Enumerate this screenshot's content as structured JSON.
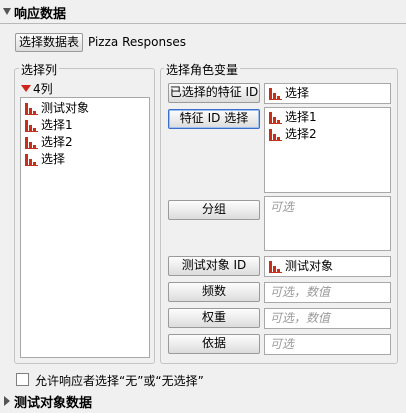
{
  "header": {
    "title": "响应数据"
  },
  "data_table": {
    "button_label": "选择数据表",
    "table_name": "Pizza Responses"
  },
  "columns_panel": {
    "label": "选择列",
    "count_label": "4列",
    "items": [
      {
        "label": "测试对象",
        "icon": "bar-chart-icon"
      },
      {
        "label": "选择1",
        "icon": "bar-chart-icon"
      },
      {
        "label": "选择2",
        "icon": "bar-chart-icon"
      },
      {
        "label": "选择",
        "icon": "bar-chart-icon"
      }
    ]
  },
  "roles_panel": {
    "label": "选择角色变量",
    "roles": [
      {
        "button": "已选择的特征 ID",
        "values": [
          "选择"
        ],
        "placeholder": ""
      },
      {
        "button": "特征 ID 选择",
        "values": [
          "选择1",
          "选择2"
        ],
        "placeholder": ""
      },
      {
        "button": "分组",
        "values": [],
        "placeholder": "可选"
      },
      {
        "button": "测试对象 ID",
        "values": [
          "测试对象"
        ],
        "placeholder": ""
      },
      {
        "button": "频数",
        "values": [],
        "placeholder": "可选，数值"
      },
      {
        "button": "权重",
        "values": [],
        "placeholder": "可选，数值"
      },
      {
        "button": "依据",
        "values": [],
        "placeholder": "可选"
      }
    ]
  },
  "options": {
    "allow_none_checkbox": {
      "label": "允许响应者选择“无”或“无选择”",
      "checked": false
    }
  },
  "footer": {
    "section_title": "测试对象数据"
  },
  "colors": {
    "accent_red": "#c62f1c",
    "dropdown_red": "#d0251b"
  }
}
